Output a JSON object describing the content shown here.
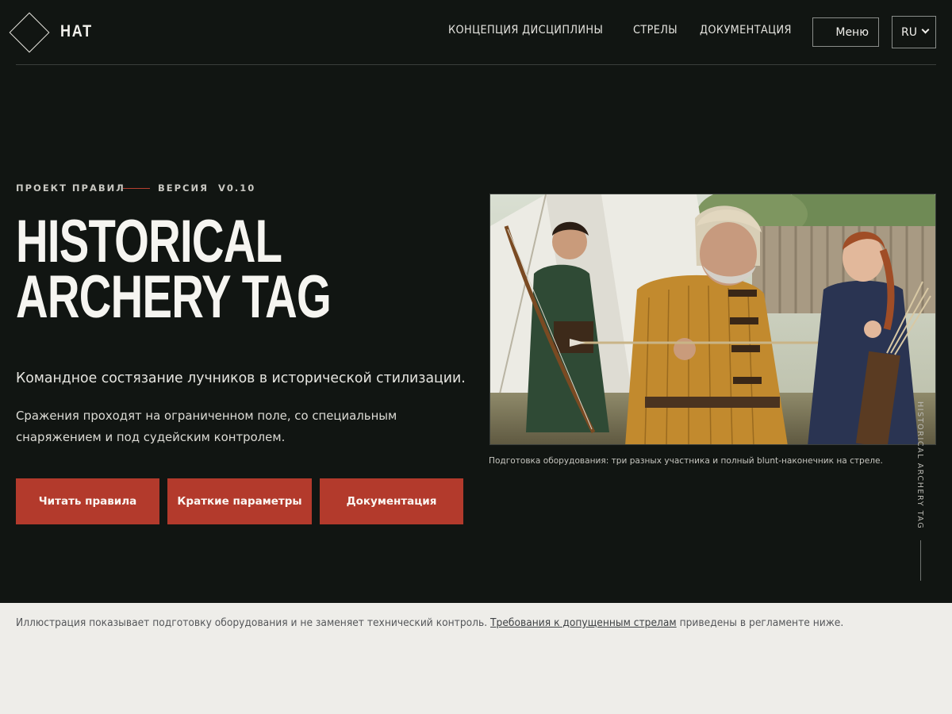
{
  "header": {
    "logo_text": "HAT",
    "nav": [
      {
        "label": "КОНЦЕПЦИЯ ДИСЦИПЛИНЫ"
      },
      {
        "label": "СТРЕЛЫ"
      },
      {
        "label": "ДОКУМЕНТАЦИЯ"
      }
    ],
    "menu_label": "Меню",
    "language": "RU"
  },
  "hero": {
    "eyebrow_left": "ПРОЕКТ ПРАВИЛ",
    "eyebrow_right": "ВЕРСИЯ  V0.10",
    "title_line1": "HISTORICAL",
    "title_line2": "ARCHERY TAG",
    "lead": "Командное состязание лучников в исторической стилизации.",
    "desc": "Сражения проходят на ограниченном поле, со специальным снаряжением и под судейским контролем.",
    "buttons": [
      {
        "label": "Читать правила"
      },
      {
        "label": "Краткие параметры"
      },
      {
        "label": "Документация"
      }
    ]
  },
  "figure": {
    "caption": "Подготовка оборудования: три разных участника и полный blunt-наконечник на стреле.",
    "side_label": "HISTORICAL ARCHERY TAG"
  },
  "note": {
    "before": "Иллюстрация показывает подготовку оборудования и не заменяет технический контроль. ",
    "link": "Требования к допущенным стрелам",
    "after": " приведены в регламенте ниже."
  },
  "colors": {
    "background": "#111512",
    "accent": "#b33a2c",
    "note_band": "#eeede9"
  }
}
